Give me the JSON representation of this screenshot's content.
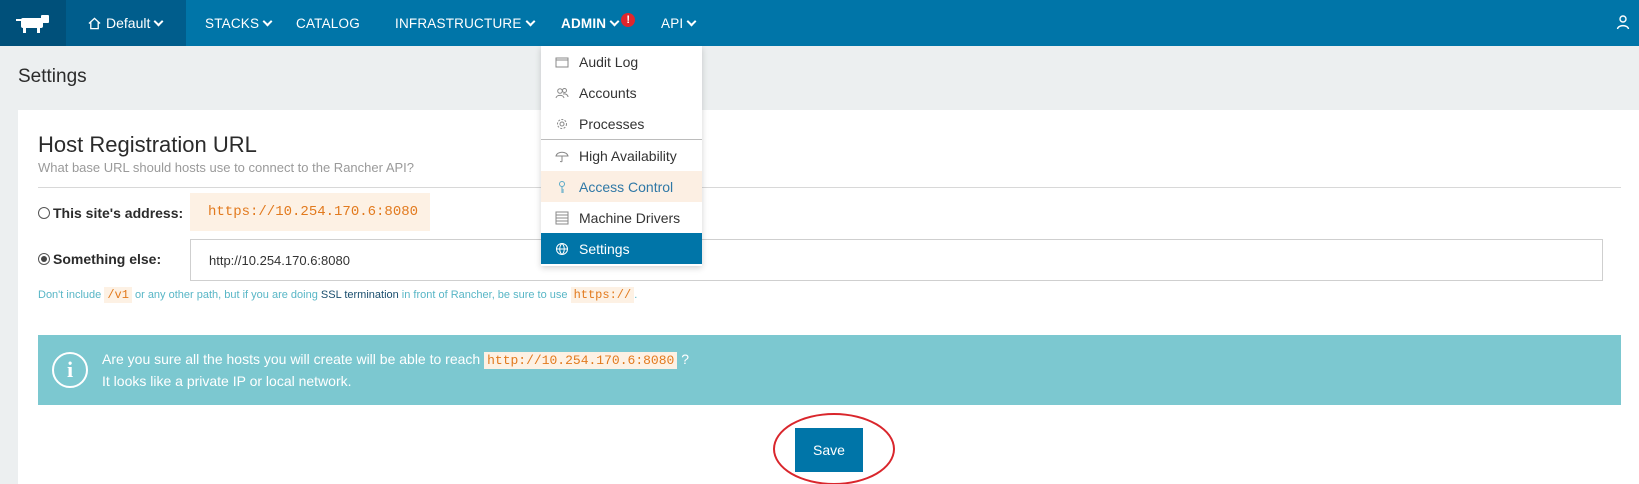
{
  "nav": {
    "environment": "Default",
    "items": [
      {
        "label": "STACKS"
      },
      {
        "label": "CATALOG"
      },
      {
        "label": "INFRASTRUCTURE"
      },
      {
        "label": "ADMIN"
      },
      {
        "label": "API"
      }
    ],
    "alert": "!"
  },
  "page": {
    "title": "Settings"
  },
  "host_registration": {
    "title": "Host Registration URL",
    "subtitle": "What base URL should hosts use to connect to the Rancher API?",
    "option_site_label": "This site's address:",
    "site_address": "https://10.254.170.6:8080",
    "option_else_label": "Something else:",
    "else_value": "http://10.254.170.6:8080",
    "selected_option": "Something else:",
    "help": {
      "p1": "Don't include ",
      "code1": "/v1",
      "p2": " or any other path, but if you are doing ",
      "link": "SSL termination",
      "p3": " in front of Rancher, be sure to use ",
      "code2": "https://",
      "p4": "."
    }
  },
  "info": {
    "icon": "i",
    "line1_pre": "Are you sure all the hosts you will create will be able to reach ",
    "line1_code": "http://10.254.170.6:8080",
    "line1_post": " ?",
    "line2": "It looks like a private IP or local network."
  },
  "actions": {
    "save": "Save"
  },
  "admin_menu": [
    {
      "label": "Audit Log",
      "icon": "audit-log-icon"
    },
    {
      "label": "Accounts",
      "icon": "accounts-icon"
    },
    {
      "label": "Processes",
      "icon": "processes-icon"
    },
    {
      "label": "High Availability",
      "icon": "high-availability-icon"
    },
    {
      "label": "Access Control",
      "icon": "access-control-icon",
      "state": "hover"
    },
    {
      "label": "Machine Drivers",
      "icon": "machine-drivers-icon"
    },
    {
      "label": "Settings",
      "icon": "settings-icon",
      "state": "selected"
    }
  ],
  "colors": {
    "nav": "#0075a8",
    "nav_dark": "#005d8c",
    "accent_orange": "#e27a1e",
    "info_bg": "#7cc8d0",
    "annotation_ring": "#d9262c"
  }
}
